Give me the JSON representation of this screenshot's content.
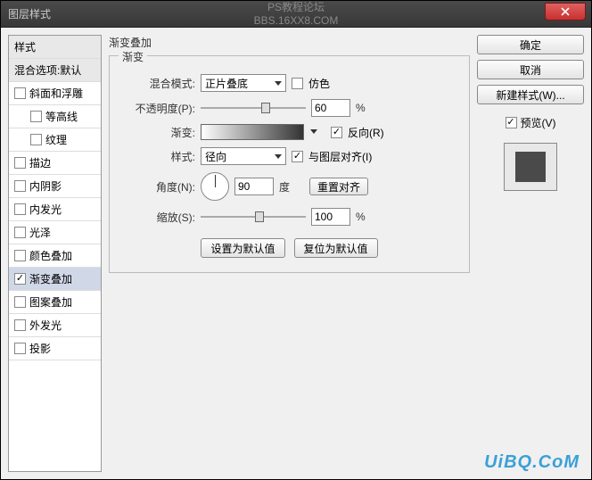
{
  "window": {
    "title": "图层样式",
    "center_line1": "PS教程论坛",
    "center_line2": "BBS.16XX8.COM"
  },
  "sidebar": {
    "header": "样式",
    "blend_header": "混合选项:默认",
    "items": [
      {
        "label": "斜面和浮雕",
        "checked": false
      },
      {
        "label": "等高线",
        "checked": false,
        "indent": true
      },
      {
        "label": "纹理",
        "checked": false,
        "indent": true
      },
      {
        "label": "描边",
        "checked": false
      },
      {
        "label": "内阴影",
        "checked": false
      },
      {
        "label": "内发光",
        "checked": false
      },
      {
        "label": "光泽",
        "checked": false
      },
      {
        "label": "颜色叠加",
        "checked": false
      },
      {
        "label": "渐变叠加",
        "checked": true,
        "selected": true
      },
      {
        "label": "图案叠加",
        "checked": false
      },
      {
        "label": "外发光",
        "checked": false
      },
      {
        "label": "投影",
        "checked": false
      }
    ]
  },
  "main": {
    "title": "渐变叠加",
    "group": "渐变",
    "blendMode": {
      "label": "混合模式:",
      "value": "正片叠底",
      "dither_label": "仿色",
      "dither": false
    },
    "opacity": {
      "label": "不透明度(P):",
      "value": "60",
      "unit": "%",
      "thumb_pct": 58
    },
    "gradient": {
      "label": "渐变:",
      "reverse_label": "反向(R)",
      "reverse": true
    },
    "style": {
      "label": "样式:",
      "value": "径向",
      "align_label": "与图层对齐(I)",
      "align": true
    },
    "angle": {
      "label": "角度(N):",
      "value": "90",
      "unit": "度",
      "reset_label": "重置对齐"
    },
    "scale": {
      "label": "缩放(S):",
      "value": "100",
      "unit": "%",
      "thumb_pct": 52
    },
    "set_default": "设置为默认值",
    "reset_default": "复位为默认值"
  },
  "right": {
    "ok": "确定",
    "cancel": "取消",
    "new_style": "新建样式(W)...",
    "preview_label": "预览(V)",
    "preview_checked": true
  },
  "watermark": "UiBQ.CoM"
}
